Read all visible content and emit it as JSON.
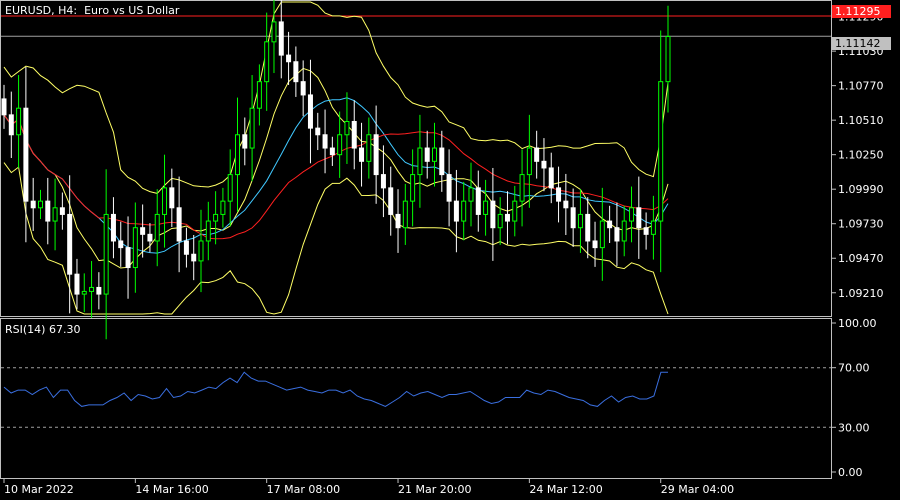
{
  "window": {
    "symbol_title": "EURUSD, H4:  Euro vs US Dollar"
  },
  "price_tags": {
    "high_line": "1.11295",
    "current_bid": "1.11142"
  },
  "indicator": {
    "rsi_label": "RSI(14) 67.30"
  },
  "colors": {
    "background": "#000000",
    "bull_candle": "#00ff00",
    "bear_candle": "#ffffff",
    "bollinger": "#ffff66",
    "ma_slow": "#ff2020",
    "ma_fast": "#40c8ff",
    "rsi_line": "#3a6fe0",
    "high_line": "#ff2020",
    "bid_line": "#a0a0a0"
  },
  "chart_data": [
    {
      "type": "candlestick",
      "title": "EURUSD, H4:  Euro vs US Dollar",
      "price_ticks": [
        "1.11290",
        "1.11030",
        "1.10770",
        "1.10510",
        "1.10250",
        "1.09990",
        "1.09730",
        "1.09470",
        "1.09210"
      ],
      "time_ticks": [
        "10 Mar 2022",
        "14 Mar 16:00",
        "17 Mar 08:00",
        "21 Mar 20:00",
        "24 Mar 12:00",
        "29 Mar 04:00"
      ],
      "ylim": [
        1.0905,
        1.114
      ],
      "horizontal_lines": [
        {
          "name": "high",
          "value": 1.11295
        },
        {
          "name": "bid",
          "value": 1.11142
        }
      ],
      "closes": [
        1.1055,
        1.104,
        1.106,
        1.099,
        1.0985,
        1.099,
        1.0975,
        1.0985,
        1.098,
        1.0935,
        1.092,
        1.0922,
        1.0925,
        1.092,
        1.098,
        1.096,
        1.0955,
        1.094,
        1.097,
        1.0965,
        1.096,
        1.098,
        1.1,
        1.0985,
        1.096,
        1.095,
        1.0945,
        1.096,
        1.0975,
        1.098,
        1.099,
        1.101,
        1.104,
        1.103,
        1.106,
        1.108,
        1.111,
        1.1125,
        1.11,
        1.1095,
        1.108,
        1.107,
        1.1045,
        1.104,
        1.103,
        1.1025,
        1.104,
        1.105,
        1.103,
        1.102,
        1.104,
        1.101,
        1.1,
        1.098,
        1.097,
        1.099,
        1.101,
        1.103,
        1.102,
        1.103,
        1.101,
        1.099,
        1.0975,
        1.099,
        1.1,
        1.098,
        1.099,
        1.097,
        1.098,
        1.0975,
        1.099,
        1.101,
        1.103,
        1.102,
        1.1015,
        1.1,
        1.099,
        1.0985,
        1.097,
        1.098,
        1.096,
        1.0955,
        1.0975,
        1.097,
        1.096,
        1.0975,
        1.0985,
        1.097,
        1.0965,
        1.0975,
        1.108,
        1.1114
      ]
    },
    {
      "type": "line",
      "title": "RSI(14) 67.30",
      "ylim": [
        0,
        100
      ],
      "y_ticks": [
        "100.00",
        "70.00",
        "30.00",
        "0.00"
      ],
      "levels": [
        70,
        30
      ],
      "values": [
        57,
        53,
        55,
        55,
        52,
        55,
        57,
        50,
        55,
        55,
        48,
        44,
        45,
        45,
        45,
        48,
        50,
        53,
        48,
        52,
        51,
        49,
        50,
        56,
        50,
        51,
        54,
        53,
        55,
        57,
        56,
        60,
        63,
        60,
        67,
        63,
        61,
        61,
        59,
        57,
        55,
        56,
        57,
        55,
        54,
        53,
        55,
        55,
        53,
        55,
        51,
        49,
        48,
        46,
        44,
        47,
        50,
        54,
        51,
        53,
        54,
        52,
        50,
        52,
        52,
        53,
        54,
        51,
        48,
        46,
        47,
        50,
        50,
        50,
        55,
        53,
        52,
        55,
        54,
        52,
        50,
        49,
        48,
        45,
        44,
        48,
        51,
        47,
        50,
        51,
        49,
        49,
        51,
        67,
        67
      ]
    }
  ]
}
